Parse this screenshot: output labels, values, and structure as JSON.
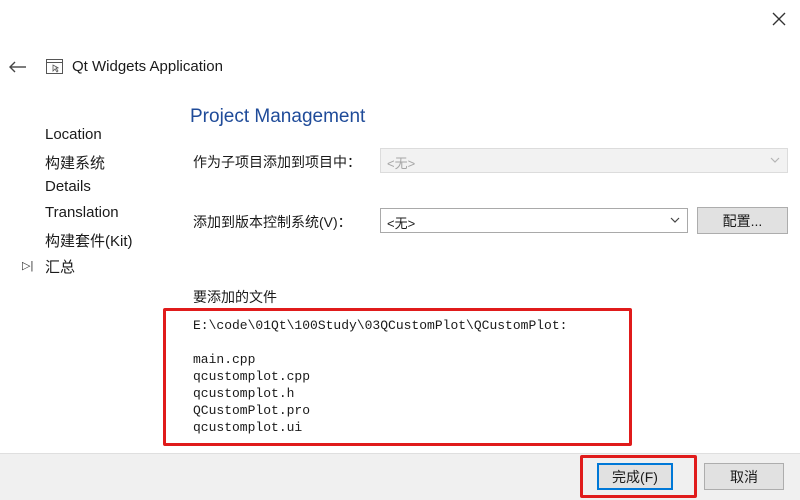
{
  "window": {
    "title": "Qt Widgets Application",
    "close_glyph": "×",
    "back_glyph": "←"
  },
  "sidebar": {
    "items": [
      {
        "label": "Location"
      },
      {
        "label": "构建系统"
      },
      {
        "label": "Details"
      },
      {
        "label": "Translation"
      },
      {
        "label": "构建套件(Kit)"
      },
      {
        "label": "汇总",
        "current": true,
        "marker": "▷|"
      }
    ]
  },
  "main": {
    "title": "Project Management",
    "add_as_subproject": {
      "label": "作为子项目添加到项目中：",
      "value": "<无>",
      "enabled": false
    },
    "add_to_vcs": {
      "label": "添加到版本控制系统(V)：",
      "value": "<无>",
      "enabled": true
    },
    "configure_label": "配置...",
    "files_label": "要添加的文件",
    "files_path": "E:\\code\\01Qt\\100Study\\03QCustomPlot\\QCustomPlot:",
    "files": [
      "main.cpp",
      "qcustomplot.cpp",
      "qcustomplot.h",
      "QCustomPlot.pro",
      "qcustomplot.ui"
    ]
  },
  "footer": {
    "finish_label": "完成(F)",
    "cancel_label": "取消"
  },
  "colors": {
    "title_blue": "#1f4b99",
    "highlight_red": "#e01b1b",
    "focus_blue": "#0078d7"
  }
}
